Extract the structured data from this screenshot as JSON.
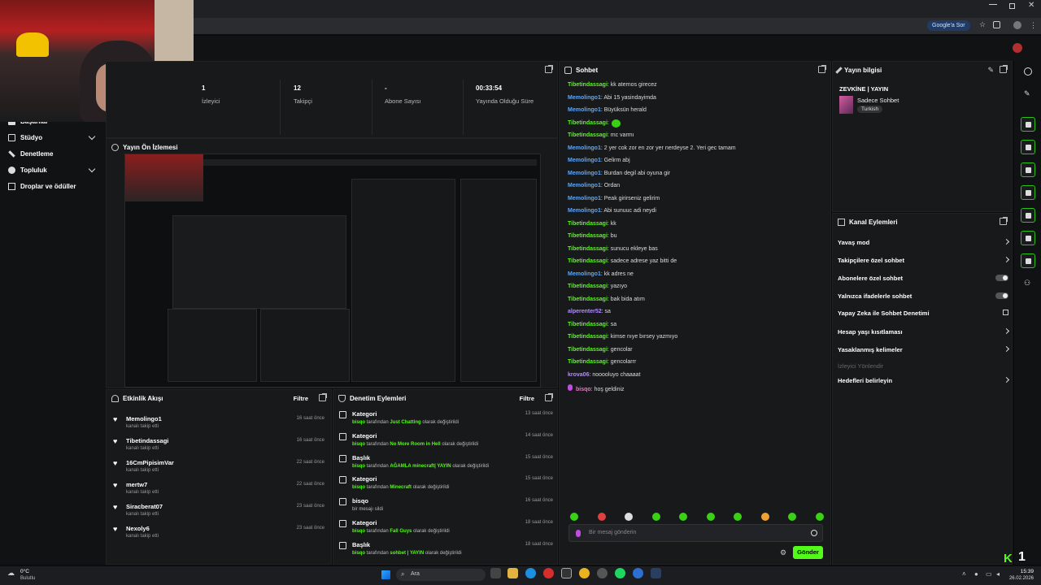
{
  "browser": {
    "google_btn": "Google'a Sor"
  },
  "nav": {
    "items": [
      {
        "label": "Başarılar"
      },
      {
        "label": "Stüdyo"
      },
      {
        "label": "Denetleme"
      },
      {
        "label": "Topluluk"
      },
      {
        "label": "Droplar ve ödüller"
      }
    ]
  },
  "stats": [
    {
      "value": "1",
      "label": "İzleyici"
    },
    {
      "value": "12",
      "label": "Takipçi"
    },
    {
      "value": "-",
      "label": "Abone Sayısı"
    },
    {
      "value": "00:33:54",
      "label": "Yayında Olduğu Süre"
    }
  ],
  "preview": {
    "title": "Yayın Ön İzlemesi"
  },
  "activity": {
    "title": "Etkinlik Akışı",
    "filter": "Filtre",
    "items": [
      {
        "name": "Memolingo1",
        "sub": "kanalı takip etti",
        "time": "16 saat önce"
      },
      {
        "name": "Tibetindassagi",
        "sub": "kanalı takip etti",
        "time": "16 saat önce"
      },
      {
        "name": "16CmPipisimVar",
        "sub": "kanalı takip etti",
        "time": "22 saat önce"
      },
      {
        "name": "mertw7",
        "sub": "kanalı takip etti",
        "time": "22 saat önce"
      },
      {
        "name": "Siracberat07",
        "sub": "kanalı takip etti",
        "time": "23 saat önce"
      },
      {
        "name": "Nexoly6",
        "sub": "kanalı takip etti",
        "time": "23 saat önce"
      }
    ]
  },
  "moderation": {
    "title": "Denetim Eylemleri",
    "filter": "Filtre",
    "items": [
      {
        "type": "Kategori",
        "actor": "bisqo",
        "pre": "tarafından",
        "hl": "Just Chatting",
        "post": "olarak değiştirildi",
        "time": "13 saat önce"
      },
      {
        "type": "Kategori",
        "actor": "bisqo",
        "pre": "tarafından",
        "hl": "No More Room in Hell",
        "post": "olarak değiştirildi",
        "time": "14 saat önce"
      },
      {
        "type": "Başlık",
        "actor": "bisqo",
        "pre": "tarafından",
        "hl": "AĞAMLA minecraft| YAYIN",
        "post": "olarak değiştirildi",
        "time": "15 saat önce"
      },
      {
        "type": "Kategori",
        "actor": "bisqo",
        "pre": "tarafından",
        "hl": "Minecraft",
        "post": "olarak değiştirildi",
        "time": "15 saat önce"
      },
      {
        "type": "bisqo",
        "actor": "",
        "pre": "bir mesajı sildi",
        "hl": "",
        "post": "",
        "time": "16 saat önce"
      },
      {
        "type": "Kategori",
        "actor": "bisqo",
        "pre": "tarafından",
        "hl": "Fall Guys",
        "post": "olarak değiştirildi",
        "time": "18 saat önce"
      },
      {
        "type": "Başlık",
        "actor": "bisqo",
        "pre": "tarafından",
        "hl": "sohbet | YAYIN",
        "post": "olarak değiştirildi",
        "time": "18 saat önce"
      }
    ]
  },
  "chat": {
    "title": "Sohbet",
    "placeholder": "Bir mesaj gönderin",
    "send": "Gönder",
    "messages": [
      {
        "user": "Tibetindassagi",
        "c": "u1",
        "text": "kk aternos girecez"
      },
      {
        "user": "Memolingo1",
        "c": "u2",
        "text": "Abi 15 yasindayimda"
      },
      {
        "user": "Memolingo1",
        "c": "u2",
        "text": "Büyüksün herald"
      },
      {
        "user": "Tibetindassagi",
        "c": "u1",
        "text": ""
      },
      {
        "user": "Tibetindassagi",
        "c": "u1",
        "text": "mc varmı"
      },
      {
        "user": "Memolingo1",
        "c": "u2",
        "text": "2 yer cok zor en zor yer nerdeyse 2. Yeri gec tamam"
      },
      {
        "user": "Memolingo1",
        "c": "u2",
        "text": "Gelirm abj"
      },
      {
        "user": "Memolingo1",
        "c": "u2",
        "text": "Burdan degil abi oyuna gir"
      },
      {
        "user": "Memolingo1",
        "c": "u2",
        "text": "Ordan"
      },
      {
        "user": "Memolingo1",
        "c": "u2",
        "text": "Peak girirseniz gelirim"
      },
      {
        "user": "Memolingo1",
        "c": "u2",
        "text": "Abi sunuuc adi neydi"
      },
      {
        "user": "Tibetindassagi",
        "c": "u1",
        "text": "kk"
      },
      {
        "user": "Tibetindassagi",
        "c": "u1",
        "text": "bu"
      },
      {
        "user": "Tibetindassagi",
        "c": "u1",
        "text": "sunucu ekleye bas"
      },
      {
        "user": "Tibetindassagi",
        "c": "u1",
        "text": "sadece adrese yaz bitti de"
      },
      {
        "user": "Memolingo1",
        "c": "u2",
        "text": "kk adres ne"
      },
      {
        "user": "Tibetindassagi",
        "c": "u1",
        "text": "yazıyo"
      },
      {
        "user": "Tibetindassagi",
        "c": "u1",
        "text": "bak bida atım"
      },
      {
        "user": "alperenter52",
        "c": "u3",
        "text": "sa"
      },
      {
        "user": "Tibetindassagi",
        "c": "u1",
        "text": "sa"
      },
      {
        "user": "Tibetindassagi",
        "c": "u1",
        "text": "kimse nıye bırsey yazmıyo"
      },
      {
        "user": "Tibetindassagi",
        "c": "u1",
        "text": "gencolar"
      },
      {
        "user": "Tibetindassagi",
        "c": "u1",
        "text": "gencolarrr"
      },
      {
        "user": "krova06",
        "c": "u3",
        "text": "nooooluyo chaaaat"
      },
      {
        "user": "bisqo",
        "c": "u4",
        "text": "hoş geldiniz"
      }
    ]
  },
  "info": {
    "title": "Yayın bilgisi",
    "stream_title": "ZEVKİNE | YAYIN",
    "category": "Sadece Sohbet",
    "language": "Turkish"
  },
  "actions": {
    "title": "Kanal Eylemleri",
    "items": [
      {
        "label": "Yavaş mod",
        "kind": "chev"
      },
      {
        "label": "Takipçilere özel sohbet",
        "kind": "chev"
      },
      {
        "label": "Abonelere özel sohbet",
        "kind": "tog"
      },
      {
        "label": "Yalnızca ifadelerle sohbet",
        "kind": "tog"
      },
      {
        "label": "Yapay Zeka ile Sohbet Denetimi",
        "kind": "ext"
      },
      {
        "label": "Hesap yaşı kısıtlaması",
        "kind": "chev"
      },
      {
        "label": "Yasaklanmış kelimeler",
        "kind": "chev"
      },
      {
        "label": "İzleyici Yönlendir",
        "kind": "dim"
      },
      {
        "label": "Hedefleri belirleyin",
        "kind": "chev"
      }
    ]
  },
  "taskbar": {
    "weather_temp": "0°C",
    "weather_desc": "Bulutlu",
    "search": "Ara",
    "time": "15:39",
    "date": "26.02.2026"
  }
}
